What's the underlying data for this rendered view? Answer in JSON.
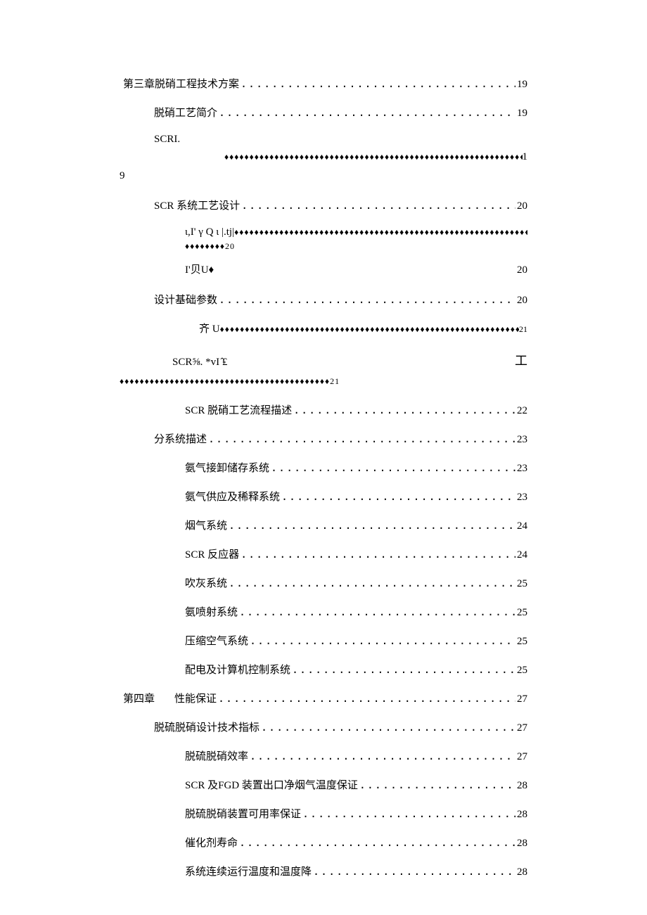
{
  "diamond": "♦♦♦♦♦♦♦♦♦♦♦♦♦♦♦♦♦♦♦♦♦♦♦♦♦♦♦♦♦♦♦♦♦♦♦♦♦♦♦♦♦♦♦♦♦♦♦♦♦♦♦♦♦♦♦♦♦♦♦♦♦♦♦♦♦♦♦♦♦♦♦♦♦♦♦♦♦♦♦♦",
  "dots": "................................................................................................................",
  "toc": {
    "ch3": {
      "label": "第三章脱硝工程技术方案",
      "page": "19"
    },
    "intro": {
      "label": "脱硝工艺简介",
      "page": "19"
    },
    "scri": {
      "label": "SCRI.",
      "trail": "1",
      "nine": "9"
    },
    "scr_design": {
      "label": "SCR 系统工艺设计",
      "page": "20"
    },
    "gamma": {
      "label": "ι,I' γ Q ι |.tj|",
      "trail": "♦♦♦♦♦♦♦♦20"
    },
    "ibeiu": {
      "label": "I'贝U♦",
      "page": "20"
    },
    "base_params": {
      "label": "设计基础参数",
      "page": "20"
    },
    "qi": {
      "label": "齐 U",
      "trail": "21"
    },
    "scr_pound": {
      "label": "SCR⅝. *vI ̂₤",
      "glyph": "工",
      "trail": "♦♦♦♦♦♦♦♦♦♦♦♦♦♦♦♦♦♦♦♦♦♦♦♦♦♦♦♦♦♦♦♦♦♦♦♦♦♦♦♦♦♦21"
    },
    "scr_flow": {
      "label": "SCR 脱硝工艺流程描述",
      "page": "22"
    },
    "subsys": {
      "label": "分系统描述",
      "page": "23"
    },
    "nh3_storage": {
      "label": "氨气接卸储存系统",
      "page": "23"
    },
    "nh3_supply": {
      "label": "氨气供应及稀释系统",
      "page": "23"
    },
    "flue": {
      "label": "烟气系统",
      "page": "24"
    },
    "reactor": {
      "label": "SCR 反应器",
      "page": "24"
    },
    "soot": {
      "label": "吹灰系统",
      "page": "25"
    },
    "nh3_inj": {
      "label": "氨喷射系统",
      "page": "25"
    },
    "air": {
      "label": "压缩空气系统",
      "page": "25"
    },
    "elec": {
      "label": "配电及计算机控制系统",
      "page": "25"
    },
    "ch4": {
      "title": "第四章",
      "label": "性能保证",
      "page": "27"
    },
    "tech_idx": {
      "label": "脱硫脱硝设计技术指标",
      "page": "27"
    },
    "efficiency": {
      "label": "脱硫脱硝效率",
      "page": "27"
    },
    "temp_guar": {
      "label": "SCR 及FGD 装置出口净烟气温度保证",
      "page": "28"
    },
    "avail": {
      "label": "脱硫脱硝装置可用率保证",
      "page": "28"
    },
    "catalyst": {
      "label": "催化剂寿命",
      "page": "28"
    },
    "cont_temp": {
      "label": "系统连续运行温度和温度降",
      "page": "28"
    }
  }
}
